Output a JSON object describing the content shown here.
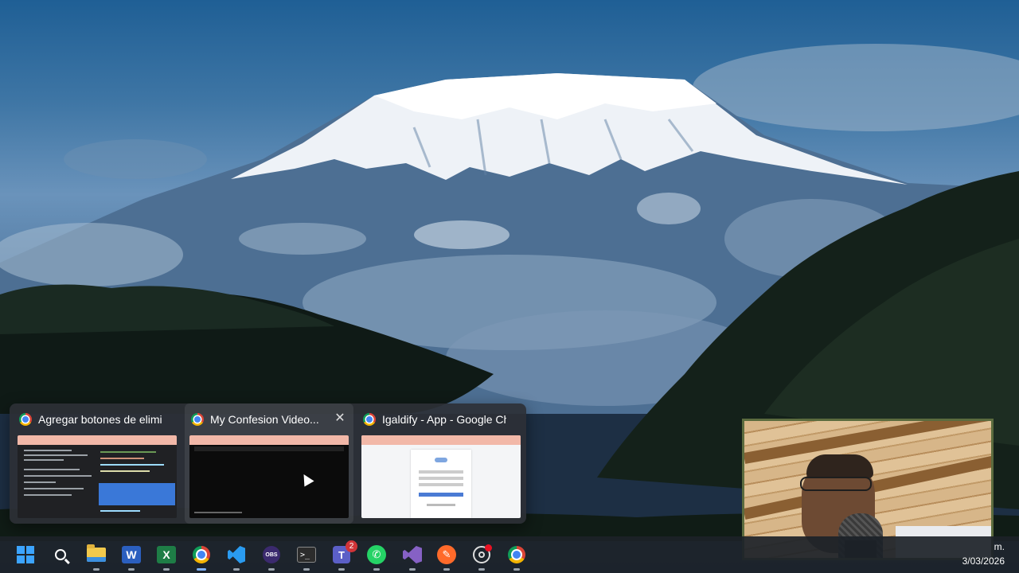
{
  "thumbnails": [
    {
      "title": "Agregar botones de elimin...",
      "app_icon": "chrome-icon",
      "preview": "code-editor-chat"
    },
    {
      "title": "My Confesion Video...",
      "app_icon": "chrome-icon",
      "preview": "youtube-video-player",
      "close_label": "✕"
    },
    {
      "title": "Igaldify - App - Google Ch...",
      "app_icon": "chrome-icon",
      "preview": "login-page"
    }
  ],
  "taskbar": {
    "icons": [
      {
        "name": "start-icon"
      },
      {
        "name": "search-icon"
      },
      {
        "name": "file-explorer-icon",
        "glyph": ""
      },
      {
        "name": "word-icon",
        "glyph": "W"
      },
      {
        "name": "excel-icon",
        "glyph": "X"
      },
      {
        "name": "chrome-icon"
      },
      {
        "name": "vscode-icon"
      },
      {
        "name": "obs-icon",
        "glyph": "OBS"
      },
      {
        "name": "terminal-icon",
        "glyph": ">_"
      },
      {
        "name": "teams-icon",
        "glyph": "T",
        "badge": "2"
      },
      {
        "name": "whatsapp-icon",
        "glyph": "✆"
      },
      {
        "name": "visual-studio-icon"
      },
      {
        "name": "paint-icon",
        "glyph": "✎"
      },
      {
        "name": "aperture-icon"
      },
      {
        "name": "chrome-icon"
      }
    ],
    "clock_time": "m.",
    "clock_date": "3/03/2026"
  },
  "colors": {
    "sky": "#2a6aa0",
    "taskbar": "#1c2228",
    "accent": "#7fb3ff",
    "badge": "#d13438"
  }
}
